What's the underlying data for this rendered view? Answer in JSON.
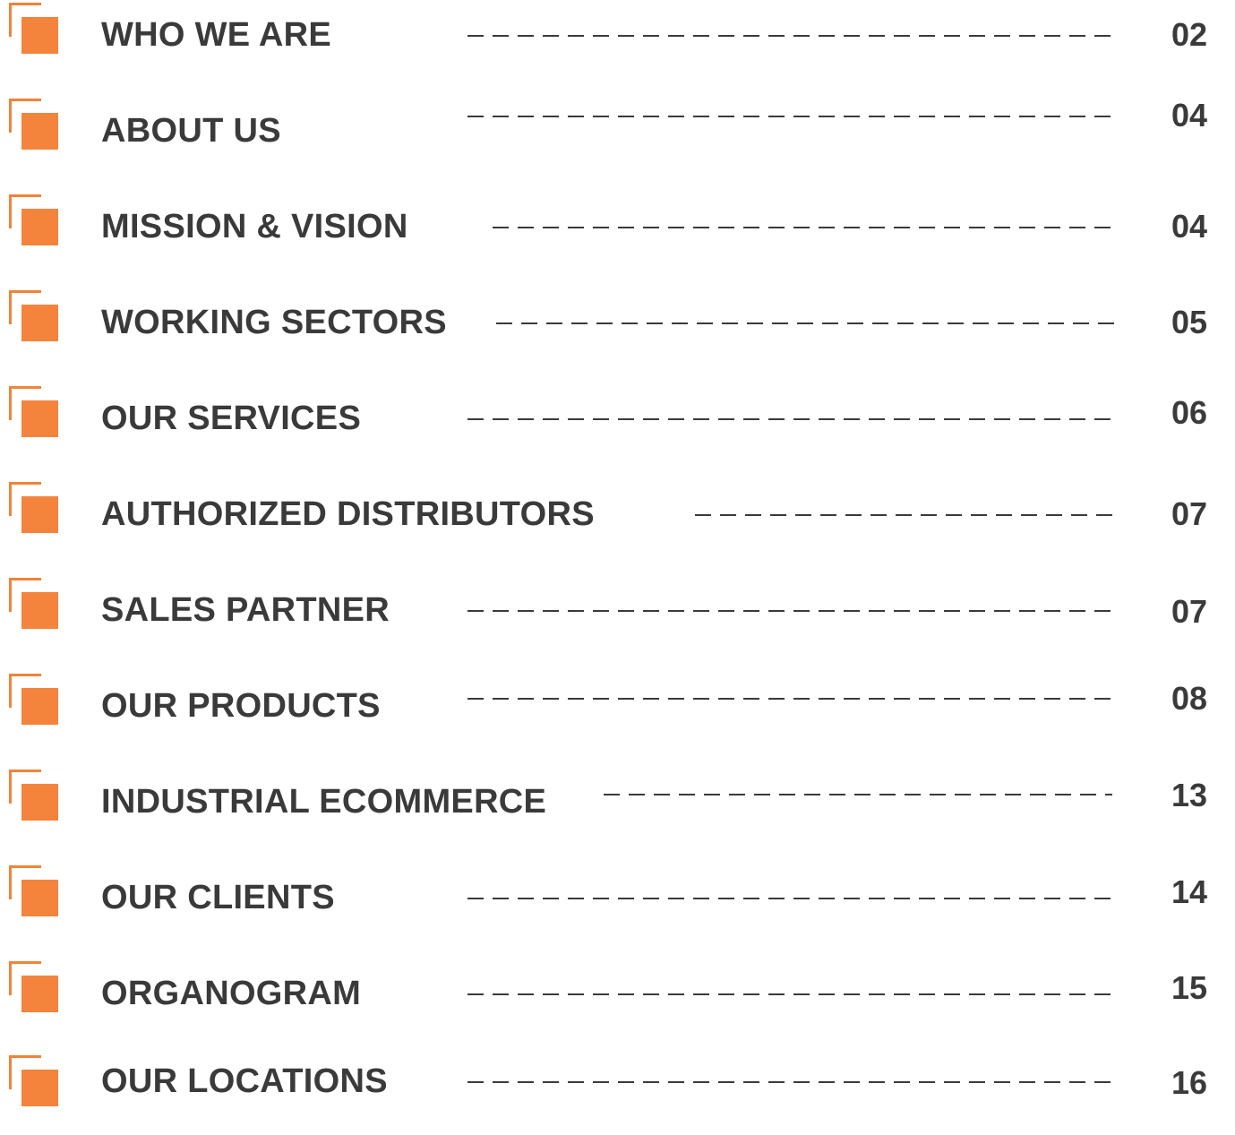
{
  "toc": {
    "items": [
      {
        "label": "WHO WE ARE",
        "page": "02"
      },
      {
        "label": "ABOUT US",
        "page": "04"
      },
      {
        "label": "MISSION & VISION",
        "page": "04"
      },
      {
        "label": "WORKING SECTORS",
        "page": "05"
      },
      {
        "label": "OUR SERVICES",
        "page": "06"
      },
      {
        "label": "AUTHORIZED DISTRIBUTORS",
        "page": "07"
      },
      {
        "label": "SALES PARTNER",
        "page": "07"
      },
      {
        "label": "OUR PRODUCTS",
        "page": "08"
      },
      {
        "label": "INDUSTRIAL ECOMMERCE",
        "page": "13"
      },
      {
        "label": "OUR CLIENTS",
        "page": "14"
      },
      {
        "label": "ORGANOGRAM",
        "page": "15"
      },
      {
        "label": "OUR LOCATIONS",
        "page": "16"
      }
    ]
  },
  "colors": {
    "accent": "#f4843c",
    "text": "#3a3a3a"
  }
}
